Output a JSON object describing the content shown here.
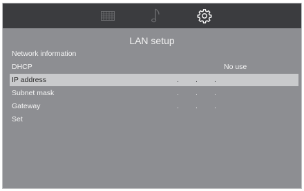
{
  "top_bar": {
    "icons": [
      "grid-icon",
      "music-note-icon",
      "gear-icon"
    ],
    "active": "gear-icon"
  },
  "page": {
    "title": "LAN setup"
  },
  "menu": [
    {
      "label": "Network information",
      "value": ""
    },
    {
      "label": "DHCP",
      "value": "No use"
    },
    {
      "label": "IP address",
      "value": ". . .",
      "selected": true
    },
    {
      "label": "Subnet mask",
      "value": ". . ."
    },
    {
      "label": "Gateway",
      "value": ". . ."
    },
    {
      "label": "Set",
      "value": ""
    }
  ],
  "colors": {
    "background": "#8d8e92",
    "top_bar": "#3b3c3f",
    "selected_row": "#c9cacc",
    "text": "#f4f4f4"
  }
}
